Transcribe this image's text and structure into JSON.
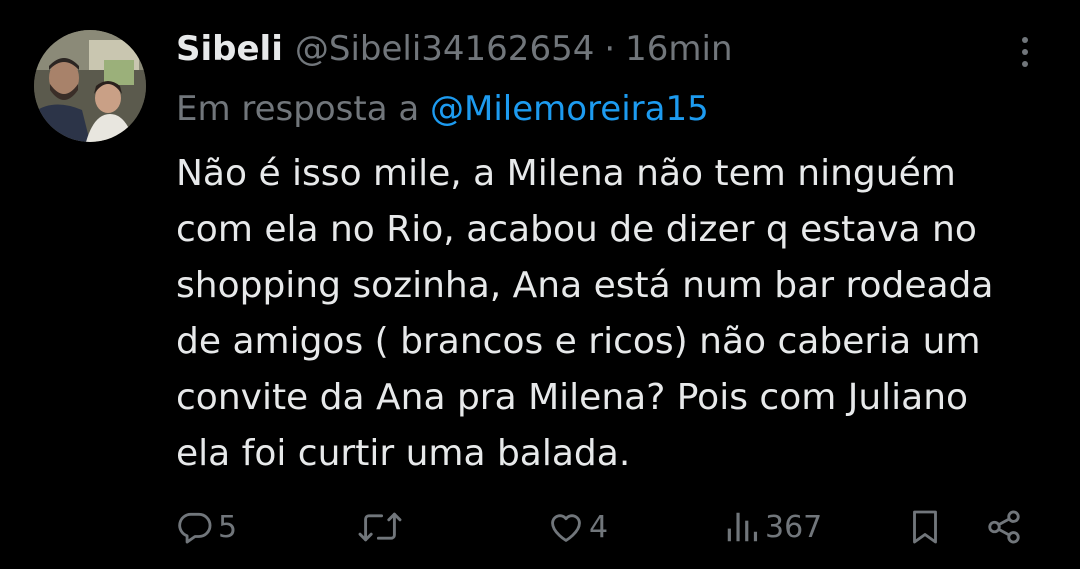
{
  "tweet": {
    "display_name": "Sibeli",
    "handle": "@Sibeli34162654",
    "separator": "·",
    "time": "16min",
    "reply_prefix": "Em resposta a",
    "reply_to": "@Milemoreira15",
    "text_lines": [
      "Não é isso mile, a Milena não tem ninguém",
      "com ela no Rio, acabou de dizer q estava no",
      "shopping sozinha, Ana está num bar rodeada",
      "de amigos ( brancos e ricos) não caberia um",
      "convite da Ana pra Milena? Pois com Juliano",
      "ela foi curtir uma balada."
    ]
  },
  "actions": {
    "replies": "5",
    "retweets": "",
    "likes": "4",
    "views": "367"
  },
  "icons": {
    "more": "more-vertical-icon",
    "reply": "reply-icon",
    "retweet": "retweet-icon",
    "like": "heart-icon",
    "views": "views-icon",
    "bookmark": "bookmark-icon",
    "share": "share-icon"
  },
  "colors": {
    "background": "#000000",
    "primary_text": "#e7e9ea",
    "secondary_text": "#71767b",
    "link": "#1d9bf0"
  }
}
